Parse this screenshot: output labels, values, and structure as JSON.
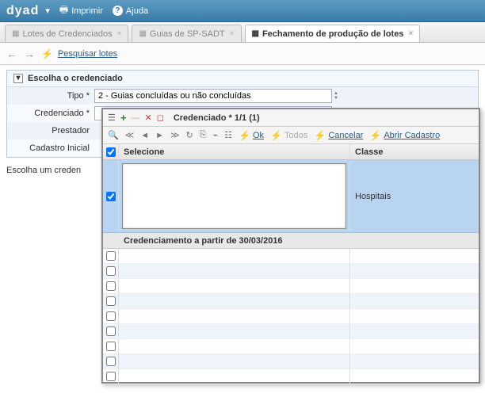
{
  "topbar": {
    "logo": "dyad",
    "print": "Imprimir",
    "help": "Ajuda"
  },
  "tabs": {
    "t1": "Lotes de Credenciados",
    "t2": "Guias de SP-SADT",
    "t3": "Fechamento de produção de lotes"
  },
  "toolbar": {
    "search": "Pesquisar lotes"
  },
  "panel": {
    "title": "Escolha o credenciado",
    "labels": {
      "tipo": "Tipo *",
      "credenciado": "Credenciado *",
      "prestador": "Prestador",
      "cadastro": "Cadastro Inicial"
    },
    "values": {
      "tipo": "2 - Guias concluídas ou não concluídas"
    }
  },
  "note": "Escolha um creden",
  "popup": {
    "title": "Credenciado *  1/1 (1)",
    "actions": {
      "ok": "Ok",
      "todos": "Todos",
      "cancelar": "Cancelar",
      "abrir": "Abrir Cadastro"
    },
    "cols": {
      "sel": "Selecione",
      "classe": "Classe"
    },
    "row_classe": "Hospitais",
    "info": "Credenciamento a partir de 30/03/2016"
  }
}
